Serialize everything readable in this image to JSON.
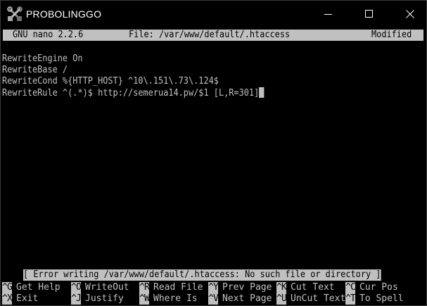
{
  "window": {
    "title": "PROBOLINGGO"
  },
  "nano": {
    "version": "GNU nano 2.2.6",
    "file": "File: /var/www/default/.htaccess",
    "state": "Modified"
  },
  "editor": {
    "lines": [
      "RewriteEngine On",
      "RewriteBase /",
      "RewriteCond %{HTTP_HOST} ^10\\.151\\.73\\.124$",
      "RewriteRule ^(.*)$ http://semerua14.pw/$1 [L,R=301]"
    ]
  },
  "status": {
    "message": "[ Error writing /var/www/default/.htaccess: No such file or directory ]"
  },
  "shortcuts": {
    "row1": [
      {
        "key": "^G",
        "label": "Get Help"
      },
      {
        "key": "^O",
        "label": "WriteOut"
      },
      {
        "key": "^R",
        "label": "Read File"
      },
      {
        "key": "^Y",
        "label": "Prev Page"
      },
      {
        "key": "^K",
        "label": "Cut Text"
      },
      {
        "key": "^C",
        "label": "Cur Pos"
      }
    ],
    "row2": [
      {
        "key": "^X",
        "label": "Exit"
      },
      {
        "key": "^J",
        "label": "Justify"
      },
      {
        "key": "^W",
        "label": "Where Is"
      },
      {
        "key": "^V",
        "label": "Next Page"
      },
      {
        "key": "^U",
        "label": "UnCut Text"
      },
      {
        "key": "^T",
        "label": "To Spell"
      }
    ]
  },
  "colors": {
    "background": "#000000",
    "text": "#c0c0c0",
    "highlight": "#c0c0c0"
  },
  "icons": {
    "app": "x-tools-icon",
    "minimize": "minimize-icon",
    "maximize": "maximize-icon",
    "close": "close-icon"
  }
}
